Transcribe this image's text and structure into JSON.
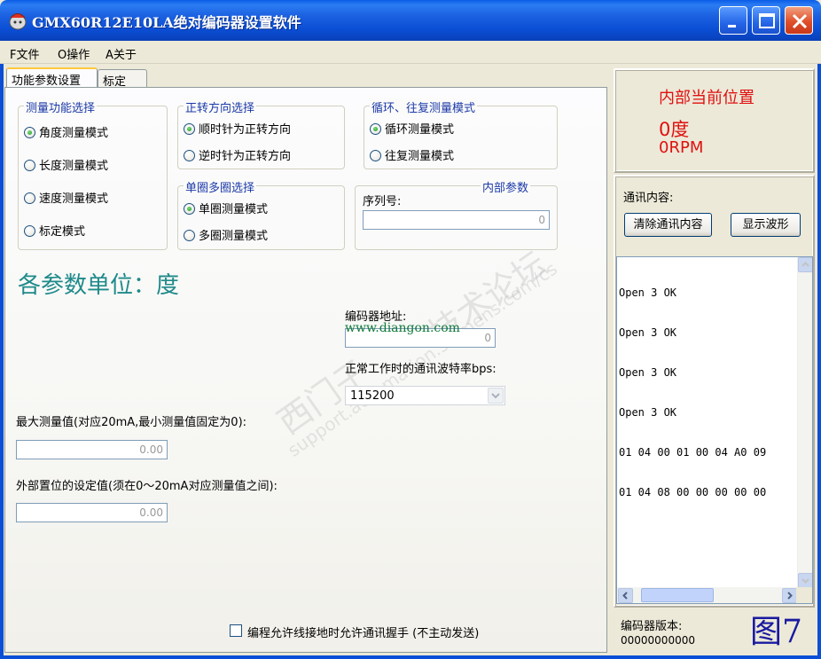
{
  "window": {
    "title": "GMX60R12E10LA绝对编码器设置软件"
  },
  "menu": {
    "file": "F文件",
    "operate": "O操作",
    "about": "A关于"
  },
  "tabs": [
    {
      "label": "功能参数设置",
      "active": true
    },
    {
      "label": "标定",
      "active": false
    }
  ],
  "measure_function": {
    "title": "测量功能选择",
    "options": [
      {
        "label": "角度测量模式",
        "selected": true
      },
      {
        "label": "长度测量模式",
        "selected": false
      },
      {
        "label": "速度测量模式",
        "selected": false
      },
      {
        "label": "标定模式",
        "selected": false
      }
    ]
  },
  "direction": {
    "title": "正转方向选择",
    "options": [
      {
        "label": "顺时针为正转方向",
        "selected": true
      },
      {
        "label": "逆时针为正转方向",
        "selected": false
      }
    ]
  },
  "cycle_mode": {
    "title": "循环、往复测量模式",
    "options": [
      {
        "label": "循环测量模式",
        "selected": true
      },
      {
        "label": "往复测量模式",
        "selected": false
      }
    ]
  },
  "turns": {
    "title": "单圈多圈选择",
    "options": [
      {
        "label": "单圈测量模式",
        "selected": true
      },
      {
        "label": "多圈测量模式",
        "selected": false
      }
    ]
  },
  "internal_params": {
    "title": "内部参数",
    "serial_label": "序列号:",
    "serial_value": "0"
  },
  "units_label": "各参数单位：度",
  "encoder_address": {
    "label": "编码器地址:",
    "value": "0"
  },
  "baud": {
    "label": "正常工作时的通讯波特率bps:",
    "value": "115200"
  },
  "max_value": {
    "label": "最大测量值(对应20mA,最小测量值固定为0):",
    "value": "0.00"
  },
  "external_preset": {
    "label": "外部置位的设定值(须在0～20mA对应测量值之间):",
    "value": "0.00"
  },
  "handshake": {
    "label": "编程允许线接地时允许通讯握手 (不主动发送)",
    "checked": false
  },
  "watermarks": {
    "link": "www.diangon.com",
    "text1": "西门子",
    "text2": "技术论坛",
    "text3": "support.automation.siemens.com/cs"
  },
  "position": {
    "title": "内部当前位置",
    "angle": "0度",
    "speed": "0RPM"
  },
  "comm": {
    "label": "通讯内容:",
    "clear_button": "清除通讯内容",
    "wave_button": "显示波形",
    "log": [
      "Open 3 OK",
      "Open 3 OK",
      "Open 3 OK",
      "Open 3 OK",
      "01 04 00 01 00 04 A0 09",
      "01 04 08 00 00 00 00 00"
    ]
  },
  "version": {
    "label": "编码器版本:",
    "value": "00000000000"
  },
  "figure_label": "图7",
  "colors": {
    "titlebar": "#0b4fd6",
    "group_title": "#1c3aa8",
    "position_red": "#e01010",
    "units_teal": "#1f8a8a"
  }
}
